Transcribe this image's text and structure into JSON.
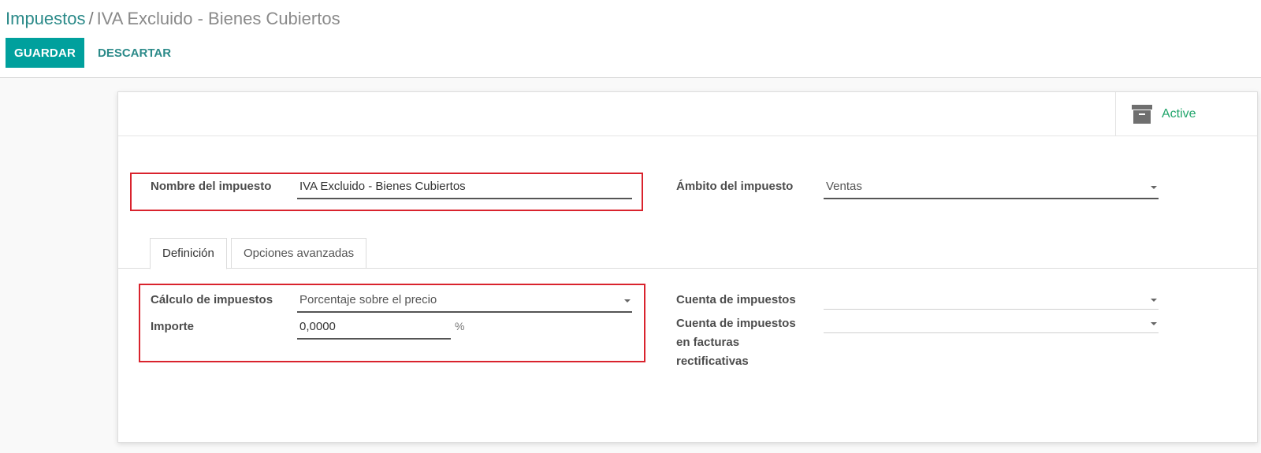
{
  "breadcrumb": {
    "parent": "Impuestos",
    "separator": "/",
    "current": "IVA Excluido - Bienes Cubiertos"
  },
  "toolbar": {
    "save_label": "GUARDAR",
    "discard_label": "DESCARTAR"
  },
  "button_box": {
    "active_label": "Active",
    "active_icon": "archive-icon"
  },
  "form": {
    "name_label": "Nombre del impuesto",
    "name_value": "IVA Excluido -  Bienes Cubiertos",
    "scope_label": "Ámbito del impuesto",
    "scope_value": "Ventas"
  },
  "tabs": [
    {
      "label": "Definición",
      "active": true
    },
    {
      "label": "Opciones avanzadas",
      "active": false
    }
  ],
  "definition": {
    "computation_label": "Cálculo de impuestos",
    "computation_value": "Porcentaje sobre el precio",
    "amount_label": "Importe",
    "amount_value": "0,0000",
    "amount_unit": "%",
    "account_label": "Cuenta de impuestos",
    "account_value": "",
    "refund_account_label_line1": "Cuenta de impuestos",
    "refund_account_label_line2": "en facturas",
    "refund_account_label_line3": "rectificativas",
    "refund_account_value": ""
  },
  "colors": {
    "primary": "#00a09d",
    "link": "#2b8a89",
    "active_green": "#21a56b",
    "highlight_red": "#d9232d"
  }
}
